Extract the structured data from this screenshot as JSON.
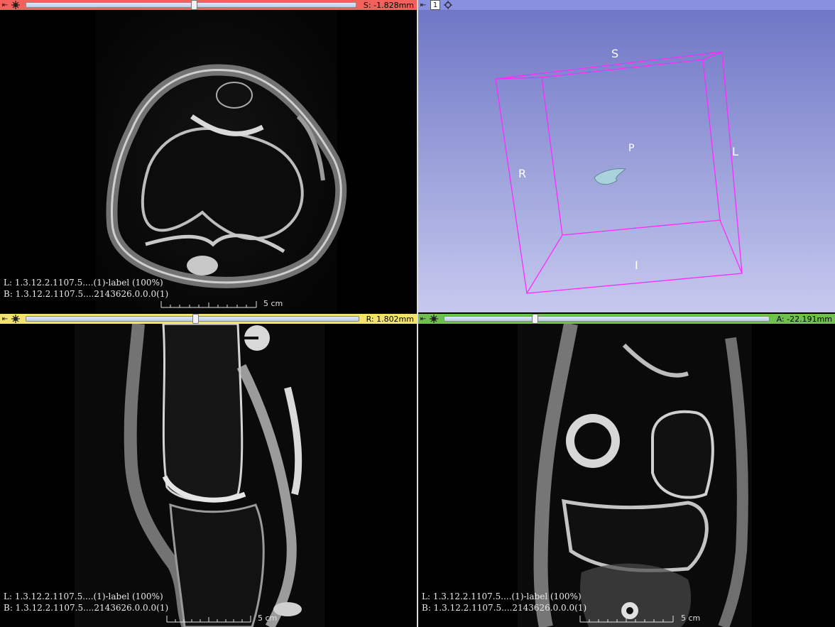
{
  "colors": {
    "red_bar": "#f2615b",
    "yellow_bar": "#f2e270",
    "green_bar": "#6fc14e",
    "blue_bar": "#8890e0",
    "threed_background_top": "#6c74c4",
    "threed_background_bottom": "#c6c9ee",
    "bounding_box": "#ff2aff"
  },
  "views": {
    "red": {
      "readout": "S: -1.828mm",
      "slider_fraction": 0.5,
      "label_line": "L: 1.3.12.2.1107.5....(1)-label (100%)",
      "background_line": "B: 1.3.12.2.1107.5....2143626.0.0.0(1)",
      "ruler_label": "5 cm"
    },
    "yellow": {
      "readout": "R: 1.802mm",
      "slider_fraction": 0.5,
      "label_line": "L: 1.3.12.2.1107.5....(1)-label (100%)",
      "background_line": "B: 1.3.12.2.1107.5....2143626.0.0.0(1)",
      "ruler_label": "5 cm"
    },
    "green": {
      "readout": "A: -22.191mm",
      "slider_fraction": 0.27,
      "label_line": "L: 1.3.12.2.1107.5....(1)-label (100%)",
      "background_line": "B: 1.3.12.2.1107.5....2143626.0.0.0(1)",
      "ruler_label": "5 cm"
    },
    "threed": {
      "view_number": "1",
      "orientation_labels": {
        "s": "S",
        "i": "I",
        "r": "R",
        "l": "L",
        "p": "P"
      }
    }
  },
  "icons": {
    "pin": "pin-icon",
    "link": "link-icon",
    "center": "center-view-icon"
  }
}
